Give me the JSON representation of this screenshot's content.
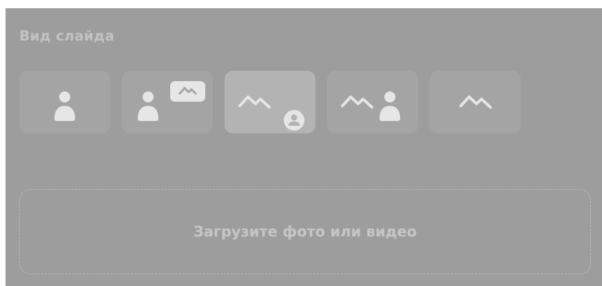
{
  "slide_view": {
    "title": "Вид слайда",
    "options": [
      {
        "name": "person-only",
        "icons": [
          "person-icon"
        ],
        "selected": false
      },
      {
        "name": "person-with-small-image",
        "icons": [
          "person-icon",
          "image-badge-icon"
        ],
        "selected": false
      },
      {
        "name": "image-with-avatar",
        "icons": [
          "mountain-icon",
          "avatar-badge-icon"
        ],
        "selected": true
      },
      {
        "name": "image-and-person",
        "icons": [
          "mountain-icon",
          "person-icon"
        ],
        "selected": false
      },
      {
        "name": "image-only",
        "icons": [
          "mountain-icon"
        ],
        "selected": false
      }
    ]
  },
  "upload": {
    "label": "Загрузите фото или видео"
  },
  "colors": {
    "panel_background": "#9d9d9d",
    "option_background": "#a4a4a4",
    "option_selected_background": "#b3b3b3",
    "icon_color": "#e6e6e6",
    "text_color": "#c6c6c6"
  }
}
